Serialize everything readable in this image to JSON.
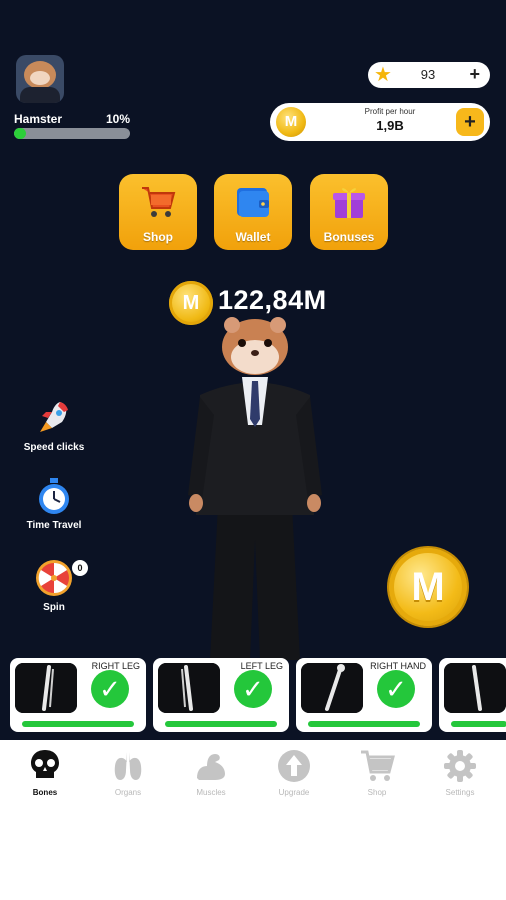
{
  "player": {
    "name": "Hamster",
    "level_percent_label": "10%",
    "level_progress": 0.1
  },
  "stars": {
    "value": "93",
    "plus": "+"
  },
  "profit": {
    "label": "Profit per hour",
    "value": "1,9B",
    "plus": "+",
    "coin_letter": "M"
  },
  "actions": [
    {
      "label": "Shop",
      "icon": "shopping-cart-icon"
    },
    {
      "label": "Wallet",
      "icon": "wallet-icon"
    },
    {
      "label": "Bonuses",
      "icon": "gift-icon"
    }
  ],
  "balance": {
    "value": "122,84M",
    "coin_letter": "M"
  },
  "tools": [
    {
      "label": "Speed clicks",
      "icon": "rocket-icon"
    },
    {
      "label": "Time Travel",
      "icon": "stopwatch-icon"
    },
    {
      "label": "Spin",
      "icon": "wheel-icon",
      "badge": "0"
    }
  ],
  "tap_coin": {
    "letter": "M"
  },
  "bones": [
    {
      "name": "RIGHT LEG",
      "done": true
    },
    {
      "name": "LEFT LEG",
      "done": true
    },
    {
      "name": "RIGHT HAND",
      "done": true
    },
    {
      "name": "",
      "done": false
    }
  ],
  "check_mark": "✓",
  "nav": [
    {
      "label": "Bones",
      "icon": "skull-icon",
      "active": true
    },
    {
      "label": "Organs",
      "icon": "lungs-icon",
      "active": false
    },
    {
      "label": "Muscles",
      "icon": "muscle-icon",
      "active": false
    },
    {
      "label": "Upgrade",
      "icon": "upgrade-arrow-icon",
      "active": false
    },
    {
      "label": "Shop",
      "icon": "cart-icon",
      "active": false
    },
    {
      "label": "Settings",
      "icon": "gear-icon",
      "active": false
    }
  ],
  "colors": {
    "background": "#0b1224",
    "accent_gold": "#f7b81b",
    "progress_green": "#2ccf39",
    "nav_active": "#111111",
    "nav_inactive": "#b8b8b8"
  }
}
